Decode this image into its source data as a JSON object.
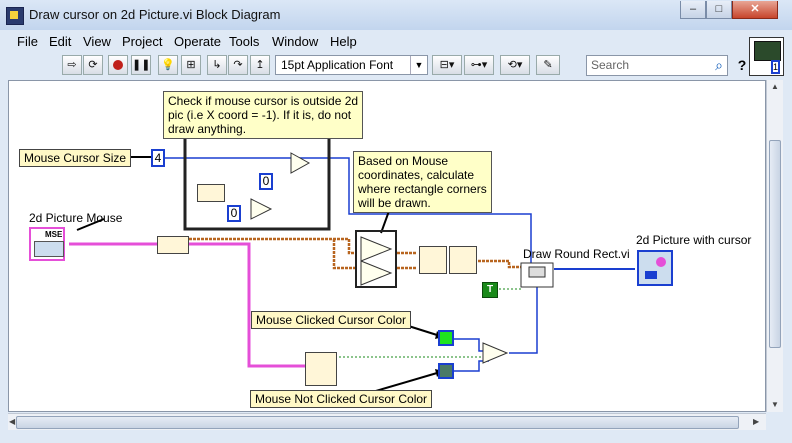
{
  "window": {
    "title": "Draw cursor on 2d Picture.vi Block Diagram"
  },
  "window_buttons": {
    "minimize": "–",
    "maximize": "□",
    "close": "✕"
  },
  "menu": [
    "File",
    "Edit",
    "View",
    "Project",
    "Operate",
    "Tools",
    "Window",
    "Help"
  ],
  "toolbar": {
    "font": "15pt Application Font",
    "search_placeholder": "Search",
    "help_label": "?",
    "connector_number": "1"
  },
  "diagram": {
    "controls": {
      "mouse_cursor_size": "Mouse Cursor Size",
      "picture_mouse": "2d Picture Mouse",
      "clicked_color": "Mouse Clicked  Cursor Color",
      "not_clicked_color": "Mouse Not Clicked Cursor Color"
    },
    "indicators": {
      "picture_with_cursor": "2d Picture with cursor"
    },
    "subvi": {
      "draw_round_rect": "Draw Round Rect.vi"
    },
    "comments": {
      "outside_check": "Check if mouse cursor is outside 2d\npic (i.e X coord = -1). If it is, do not\ndraw anything.",
      "corners": "Based on Mouse\ncoordinates, calculate\nwhere rectangle corners\nwill be drawn."
    },
    "constants": {
      "size_value": "4",
      "zero_a": "0",
      "zero_b": "0",
      "bool_true": "T",
      "mse": "MSE"
    },
    "colors": {
      "clicked": "#1fe31f",
      "not_clicked": "#4a7a66",
      "pink_wire": "#e54fd8",
      "blue_wire": "#1a3fd0",
      "orange_wire": "#b8651f",
      "green_wire": "#1a8a1a"
    }
  }
}
